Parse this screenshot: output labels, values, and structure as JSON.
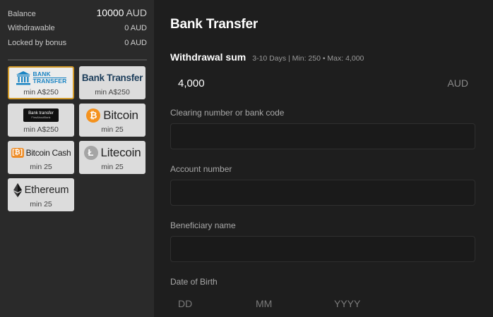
{
  "balance": {
    "balance_label": "Balance",
    "balance_value": "10000",
    "balance_currency": "AUD",
    "withdrawable_label": "Withdrawable",
    "withdrawable_value": "0 AUD",
    "locked_label": "Locked by bonus",
    "locked_value": "0 AUD"
  },
  "methods": [
    {
      "id": "bank-transfer-1",
      "logo_line1": "BANK",
      "logo_line2": "TRANSFER",
      "min": "min A$250",
      "selected": true,
      "icon": "bank-icon"
    },
    {
      "id": "bank-transfer-2",
      "logo_text": "Bank Transfer",
      "min": "min A$250"
    },
    {
      "id": "bank-transfer-3",
      "logo_line1": "Bank transfer",
      "logo_line2": "FinsAboutBank",
      "min": "min A$250"
    },
    {
      "id": "bitcoin",
      "logo_symbol": "₿",
      "logo_text": "Bitcoin",
      "min": "min 25",
      "icon": "bitcoin-icon"
    },
    {
      "id": "bitcoin-cash",
      "logo_symbol": "[₿]",
      "logo_text": "Bitcoin Cash",
      "min": "min 25",
      "icon": "bitcoin-cash-icon"
    },
    {
      "id": "litecoin",
      "logo_symbol": "Ł",
      "logo_text": "Litecoin",
      "min": "min 25",
      "icon": "litecoin-icon"
    },
    {
      "id": "ethereum",
      "logo_text": "Ethereum",
      "min": "min 25",
      "icon": "ethereum-icon"
    }
  ],
  "form": {
    "title": "Bank Transfer",
    "sum_label": "Withdrawal sum",
    "sum_info": "3-10 Days | Min: 250 • Max: 4,000",
    "sum_value": "4,000",
    "sum_currency": "AUD",
    "clearing_label": "Clearing number or bank code",
    "clearing_value": "",
    "account_label": "Account number",
    "account_value": "",
    "beneficiary_label": "Beneficiary name",
    "beneficiary_value": "",
    "dob_label": "Date of Birth",
    "dob_dd": "DD",
    "dob_mm": "MM",
    "dob_yyyy": "YYYY"
  },
  "colors": {
    "accent_border": "#d29a2a",
    "bank_blue": "#1a84c3",
    "bitcoin_orange": "#f4921e"
  }
}
